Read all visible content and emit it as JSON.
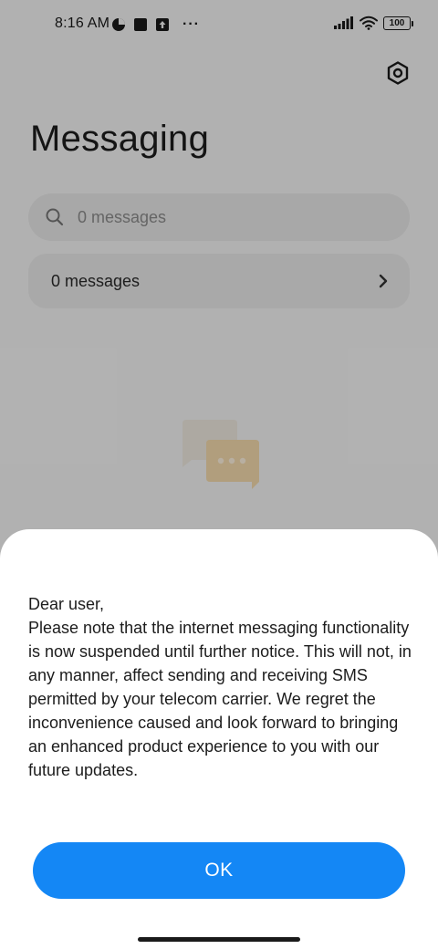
{
  "status_bar": {
    "time": "8:16 AM",
    "battery": "100",
    "overflow_dots": "···"
  },
  "header": {
    "title": "Messaging"
  },
  "search": {
    "placeholder": "0 messages"
  },
  "messages_row": {
    "label": "0 messages"
  },
  "dialog": {
    "lines": [
      "Dear user,",
      "Please note that the internet messaging functionality is now suspended until further notice. This will not, in any manner, affect sending and receiving SMS permitted by your telecom carrier. We regret the inconvenience caused and look forward to bringing an enhanced product experience to you with our future updates."
    ],
    "ok_label": "OK"
  },
  "colors": {
    "accent": "#1487f5",
    "sheet_bg": "#ffffff",
    "overlay": "rgba(0,0,0,0.28)"
  },
  "icons": {
    "settings": "hexagon-gear-icon",
    "search": "magnifier-icon",
    "chevron": "chevron-right-icon",
    "empty": "chat-bubbles-icon"
  }
}
